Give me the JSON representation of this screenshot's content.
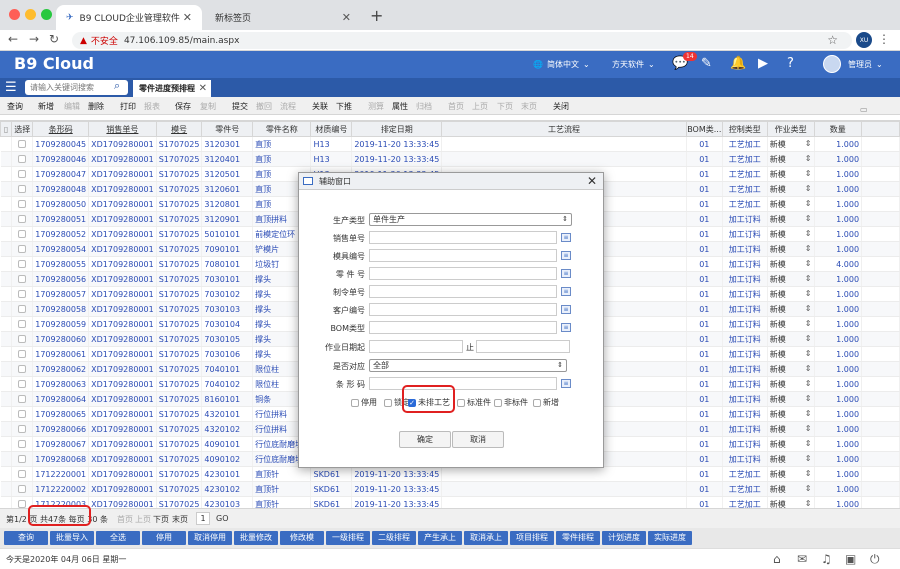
{
  "browser": {
    "tab_active": "B9 CLOUD企业管理软件",
    "tab_new": "新标签页",
    "url_prefix": "不安全",
    "url": "47.106.109.85/main.aspx",
    "avatar": "XU"
  },
  "header": {
    "logo": "B9 Cloud",
    "language": "简体中文",
    "company": "方天软件",
    "notify_count": "14",
    "user": "管理员"
  },
  "nav": {
    "search_placeholder": "请输入关键词搜索",
    "page_tab": "零件进度预排程"
  },
  "toolbar": [
    {
      "label": "查询",
      "on": true
    },
    {
      "label": "新增",
      "on": true
    },
    {
      "label": "编辑",
      "on": false
    },
    {
      "label": "删除",
      "on": true
    },
    {
      "label": "打印",
      "on": true
    },
    {
      "label": "报表",
      "on": false
    },
    {
      "label": "保存",
      "on": true
    },
    {
      "label": "复制",
      "on": false
    },
    {
      "label": "提交",
      "on": true
    },
    {
      "label": "撤回",
      "on": false
    },
    {
      "label": "流程",
      "on": false
    },
    {
      "label": "关联",
      "on": true
    },
    {
      "label": "下推",
      "on": true
    },
    {
      "label": "测算",
      "on": false
    },
    {
      "label": "属性",
      "on": true
    },
    {
      "label": "归档",
      "on": false
    },
    {
      "label": "首页",
      "on": false
    },
    {
      "label": "上页",
      "on": false
    },
    {
      "label": "下页",
      "on": false
    },
    {
      "label": "末页",
      "on": false
    },
    {
      "label": "关闭",
      "on": true
    }
  ],
  "grid": {
    "columns": [
      "选择",
      "条形码",
      "销售单号",
      "模号",
      "零件号",
      "零件名称",
      "材质编号",
      "排定日期",
      "工艺流程",
      "BOM类...",
      "控制类型",
      "作业类型",
      "数量"
    ],
    "rows": [
      [
        "1709280045",
        "XD1709280001",
        "S1707025",
        "3120301",
        "直顶",
        "H13",
        "2019-11-20 13:33:45",
        "",
        "01",
        "工艺加工",
        "新模",
        "1.000"
      ],
      [
        "1709280046",
        "XD1709280001",
        "S1707025",
        "3120401",
        "直顶",
        "H13",
        "2019-11-20 13:33:45",
        "",
        "01",
        "工艺加工",
        "新模",
        "1.000"
      ],
      [
        "1709280047",
        "XD1709280001",
        "S1707025",
        "3120501",
        "直顶",
        "H13",
        "2019-11-20 13:33:45",
        "",
        "01",
        "工艺加工",
        "新模",
        "1.000"
      ],
      [
        "1709280048",
        "XD1709280001",
        "S1707025",
        "3120601",
        "直顶",
        "H13",
        "2019-11-20 13:33:45",
        "",
        "01",
        "工艺加工",
        "新模",
        "1.000"
      ],
      [
        "1709280050",
        "XD1709280001",
        "S1707025",
        "3120801",
        "直顶",
        "H13",
        "2019-11-20 13:33:45",
        "",
        "01",
        "工艺加工",
        "新模",
        "1.000"
      ],
      [
        "1709280051",
        "XD1709280001",
        "S1707025",
        "3120901",
        "直顶拼料",
        "",
        "",
        "",
        "01",
        "加工订料",
        "新模",
        "1.000"
      ],
      [
        "1709280052",
        "XD1709280001",
        "S1707025",
        "5010101",
        "前模定位环",
        "",
        "",
        "",
        "01",
        "加工订料",
        "新模",
        "1.000"
      ],
      [
        "1709280054",
        "XD1709280001",
        "S1707025",
        "7090101",
        "铲模片",
        "",
        "",
        "",
        "01",
        "加工订料",
        "新模",
        "1.000"
      ],
      [
        "1709280055",
        "XD1709280001",
        "S1707025",
        "7080101",
        "垃圾钉",
        "",
        "",
        "",
        "01",
        "加工订料",
        "新模",
        "4.000"
      ],
      [
        "1709280056",
        "XD1709280001",
        "S1707025",
        "7030101",
        "撑头",
        "",
        "",
        "",
        "01",
        "加工订料",
        "新模",
        "1.000"
      ],
      [
        "1709280057",
        "XD1709280001",
        "S1707025",
        "7030102",
        "撑头",
        "",
        "",
        "",
        "01",
        "加工订料",
        "新模",
        "1.000"
      ],
      [
        "1709280058",
        "XD1709280001",
        "S1707025",
        "7030103",
        "撑头",
        "",
        "",
        "",
        "01",
        "加工订料",
        "新模",
        "1.000"
      ],
      [
        "1709280059",
        "XD1709280001",
        "S1707025",
        "7030104",
        "撑头",
        "",
        "",
        "",
        "01",
        "加工订料",
        "新模",
        "1.000"
      ],
      [
        "1709280060",
        "XD1709280001",
        "S1707025",
        "7030105",
        "撑头",
        "",
        "",
        "",
        "01",
        "加工订料",
        "新模",
        "1.000"
      ],
      [
        "1709280061",
        "XD1709280001",
        "S1707025",
        "7030106",
        "撑头",
        "",
        "",
        "",
        "01",
        "加工订料",
        "新模",
        "1.000"
      ],
      [
        "1709280062",
        "XD1709280001",
        "S1707025",
        "7040101",
        "限位柱",
        "",
        "",
        "",
        "01",
        "加工订料",
        "新模",
        "1.000"
      ],
      [
        "1709280063",
        "XD1709280001",
        "S1707025",
        "7040102",
        "限位柱",
        "",
        "",
        "",
        "01",
        "加工订料",
        "新模",
        "1.000"
      ],
      [
        "1709280064",
        "XD1709280001",
        "S1707025",
        "8160101",
        "铜条",
        "",
        "",
        "",
        "01",
        "加工订料",
        "新模",
        "1.000"
      ],
      [
        "1709280065",
        "XD1709280001",
        "S1707025",
        "4320101",
        "行位拼料",
        "",
        "",
        "",
        "01",
        "加工订料",
        "新模",
        "1.000"
      ],
      [
        "1709280066",
        "XD1709280001",
        "S1707025",
        "4320102",
        "行位拼料",
        "",
        "",
        "",
        "01",
        "加工订料",
        "新模",
        "1.000"
      ],
      [
        "1709280067",
        "XD1709280001",
        "S1707025",
        "4090101",
        "行位底耐磨块",
        "",
        "",
        "",
        "01",
        "加工订料",
        "新模",
        "1.000"
      ],
      [
        "1709280068",
        "XD1709280001",
        "S1707025",
        "4090102",
        "行位底耐磨块",
        "",
        "",
        "",
        "01",
        "加工订料",
        "新模",
        "1.000"
      ],
      [
        "1712220001",
        "XD1709280001",
        "S1707025",
        "4230101",
        "直顶针",
        "SKD61",
        "2019-11-20 13:33:45",
        "",
        "01",
        "工艺加工",
        "新模",
        "1.000"
      ],
      [
        "1712220002",
        "XD1709280001",
        "S1707025",
        "4230102",
        "直顶针",
        "SKD61",
        "2019-11-20 13:33:45",
        "",
        "01",
        "工艺加工",
        "新模",
        "1.000"
      ],
      [
        "1712220003",
        "XD1709280001",
        "S1707025",
        "4230103",
        "直顶针",
        "SKD61",
        "2019-11-20 13:33:45",
        "",
        "01",
        "工艺加工",
        "新模",
        "1.000"
      ]
    ]
  },
  "pager": {
    "info": "第1/2 页 共47条 每页 30 条",
    "first": "首页",
    "prev": "上页",
    "next": "下页",
    "last": "末页",
    "page": "1",
    "go": "GO"
  },
  "buttons": [
    "查询",
    "批量导入",
    "全选",
    "停用",
    "取消停用",
    "批量修改",
    "修改模",
    "一级排程",
    "二级排程",
    "产生承上",
    "取消承上",
    "项目排程",
    "零件排程",
    "计划进度",
    "实际进度"
  ],
  "status": {
    "date": "今天是2020年 04月 06日 星期一"
  },
  "dialog": {
    "title": "辅助窗口",
    "fields": {
      "prod_type_label": "生产类型",
      "prod_type_value": "单件生产",
      "sales_no": "销售单号",
      "mold_no": "模具编号",
      "part_no": "零 件 号",
      "order_no": "制令单号",
      "customer_no": "客户编号",
      "bom_type": "BOM类型",
      "date_from": "作业日期起",
      "date_to": "止",
      "match_label": "是否对应",
      "match_value": "全部",
      "barcode": "条 形 码"
    },
    "options": [
      {
        "label": "停用",
        "checked": false
      },
      {
        "label": "锁定",
        "checked": false
      },
      {
        "label": "未排工艺",
        "checked": true
      },
      {
        "label": "标准件",
        "checked": false
      },
      {
        "label": "非标件",
        "checked": false
      },
      {
        "label": "新增",
        "checked": false
      }
    ],
    "ok": "确定",
    "cancel": "取消"
  }
}
